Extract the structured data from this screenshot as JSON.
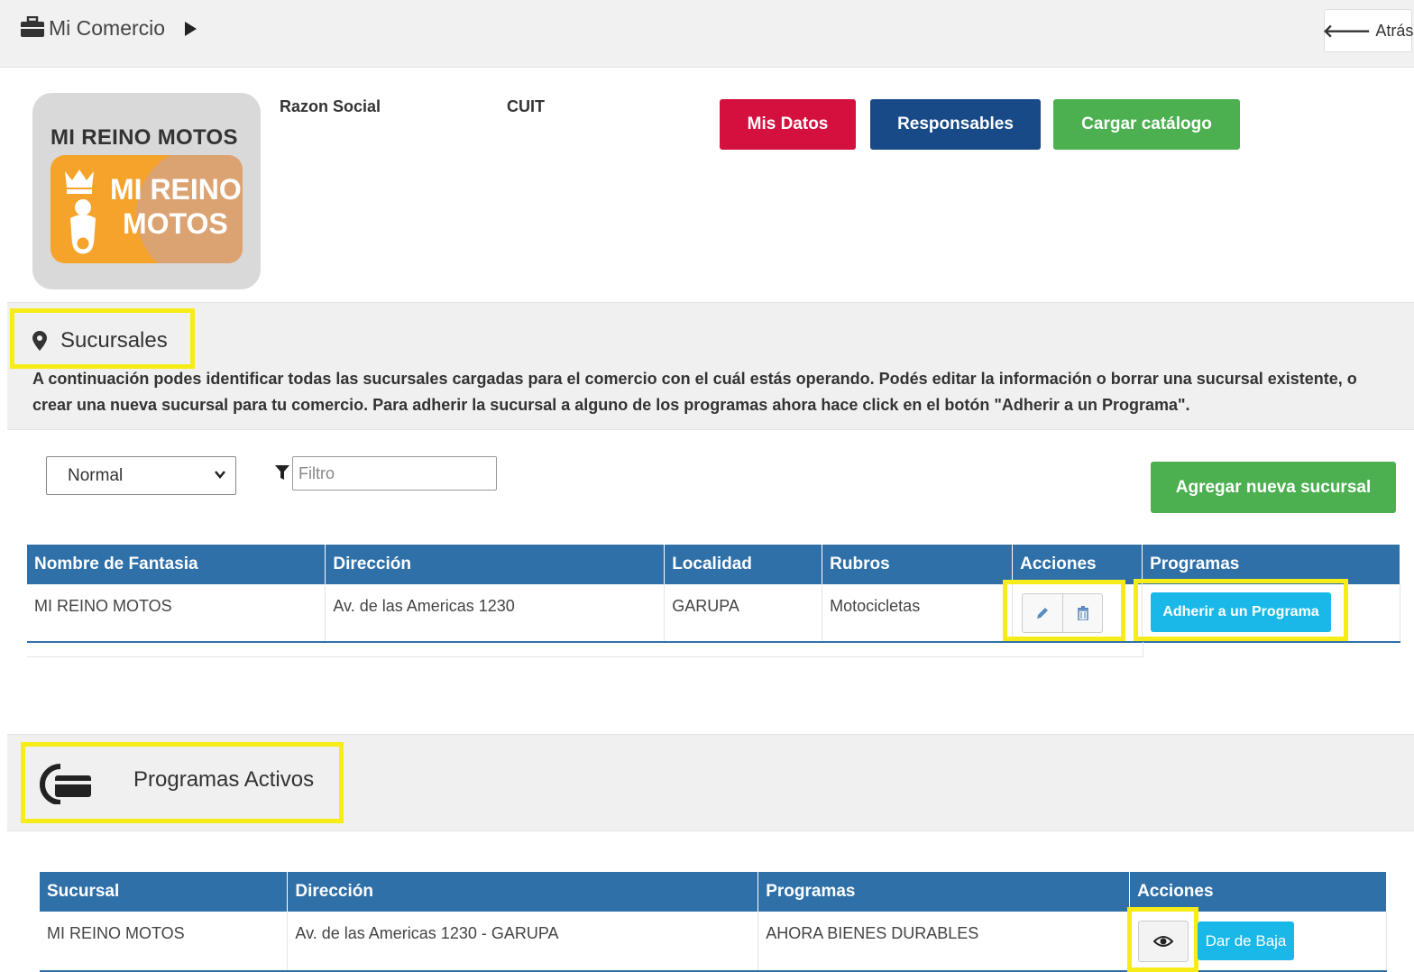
{
  "topbar": {
    "crumb": "Mi Comercio",
    "back_label": "Atrás"
  },
  "merchant": {
    "logo_title": "MI REINO MOTOS",
    "logo_line1": "MI REINO",
    "logo_line2": "MOTOS",
    "razon_social_label": "Razon Social",
    "cuit_label": "CUIT"
  },
  "actions": {
    "mis_datos": "Mis Datos",
    "responsables": "Responsables",
    "cargar_catalogo": "Cargar catálogo"
  },
  "sucursales": {
    "title": "Sucursales",
    "description": "A continuación podes identificar todas las sucursales cargadas para el comercio con el cuál estás operando. Podés editar la información o borrar una sucursal existente, o crear una nueva sucursal para tu comercio. Para adherir la sucursal a alguno de los programas ahora hace click en el botón \"Adherir a un Programa\".",
    "select_value": "Normal",
    "filter_placeholder": "Filtro",
    "add_button": "Agregar nueva sucursal",
    "columns": [
      "Nombre de Fantasia",
      "Dirección",
      "Localidad",
      "Rubros",
      "Acciones",
      "Programas"
    ],
    "rows": [
      {
        "nombre": "MI REINO MOTOS",
        "direccion": "Av. de las Americas 1230",
        "localidad": "GARUPA",
        "rubros": "Motocicletas",
        "programa_button": "Adherir a un Programa"
      }
    ]
  },
  "programas": {
    "title": "Programas Activos",
    "columns": [
      "Sucursal",
      "Dirección",
      "Programas",
      "Acciones"
    ],
    "rows": [
      {
        "sucursal": "MI REINO MOTOS",
        "direccion": "Av. de las Americas 1230 - GARUPA",
        "programa": "AHORA BIENES DURABLES",
        "baja_button": "Dar de Baja"
      }
    ]
  },
  "colors": {
    "highlight": "#f6ec18",
    "table_header": "#2f70a8",
    "red": "#d4103f",
    "navy": "#174a86",
    "green": "#4caf50",
    "cyan": "#1ab8e8"
  }
}
